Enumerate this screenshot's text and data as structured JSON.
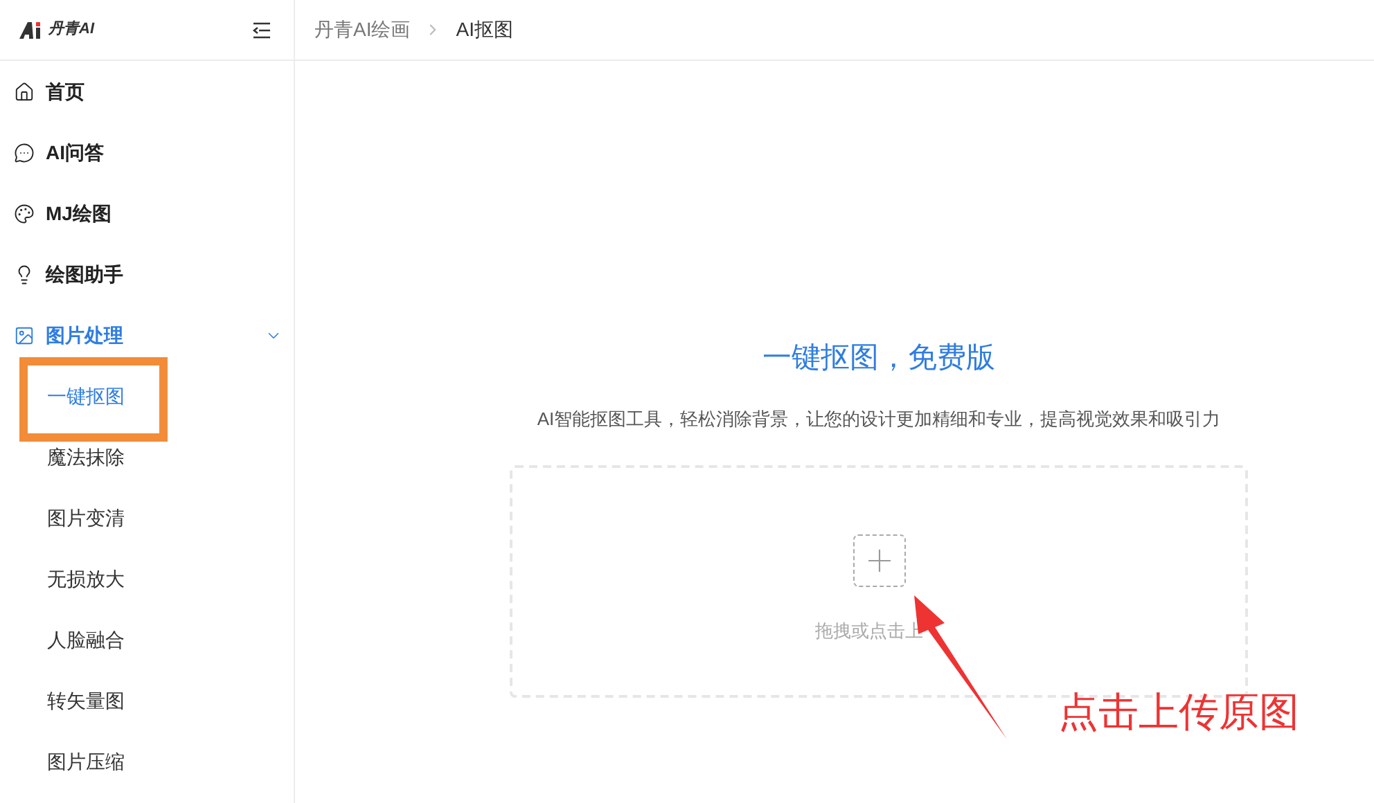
{
  "logo": {
    "text": "丹青AI"
  },
  "breadcrumb": [
    "丹青AI绘画",
    "AI抠图"
  ],
  "sidebar": {
    "items": [
      {
        "label": "首页"
      },
      {
        "label": "AI问答"
      },
      {
        "label": "MJ绘图"
      },
      {
        "label": "绘图助手"
      },
      {
        "label": "图片处理",
        "expanded": true,
        "children": [
          {
            "label": "一键抠图",
            "selected": true
          },
          {
            "label": "魔法抹除",
            "selected": false
          },
          {
            "label": "图片变清",
            "selected": false
          },
          {
            "label": "无损放大",
            "selected": false
          },
          {
            "label": "人脸融合",
            "selected": false
          },
          {
            "label": "转矢量图",
            "selected": false
          },
          {
            "label": "图片压缩",
            "selected": false
          }
        ]
      }
    ]
  },
  "main": {
    "title": "一键抠图，免费版",
    "subtitle": "AI智能抠图工具，轻松消除背景，让您的设计更加精细和专业，提高视觉效果和吸引力",
    "upload": {
      "hint": "拖拽或点击上"
    }
  },
  "annotation": {
    "text": "点击上传原图"
  }
}
